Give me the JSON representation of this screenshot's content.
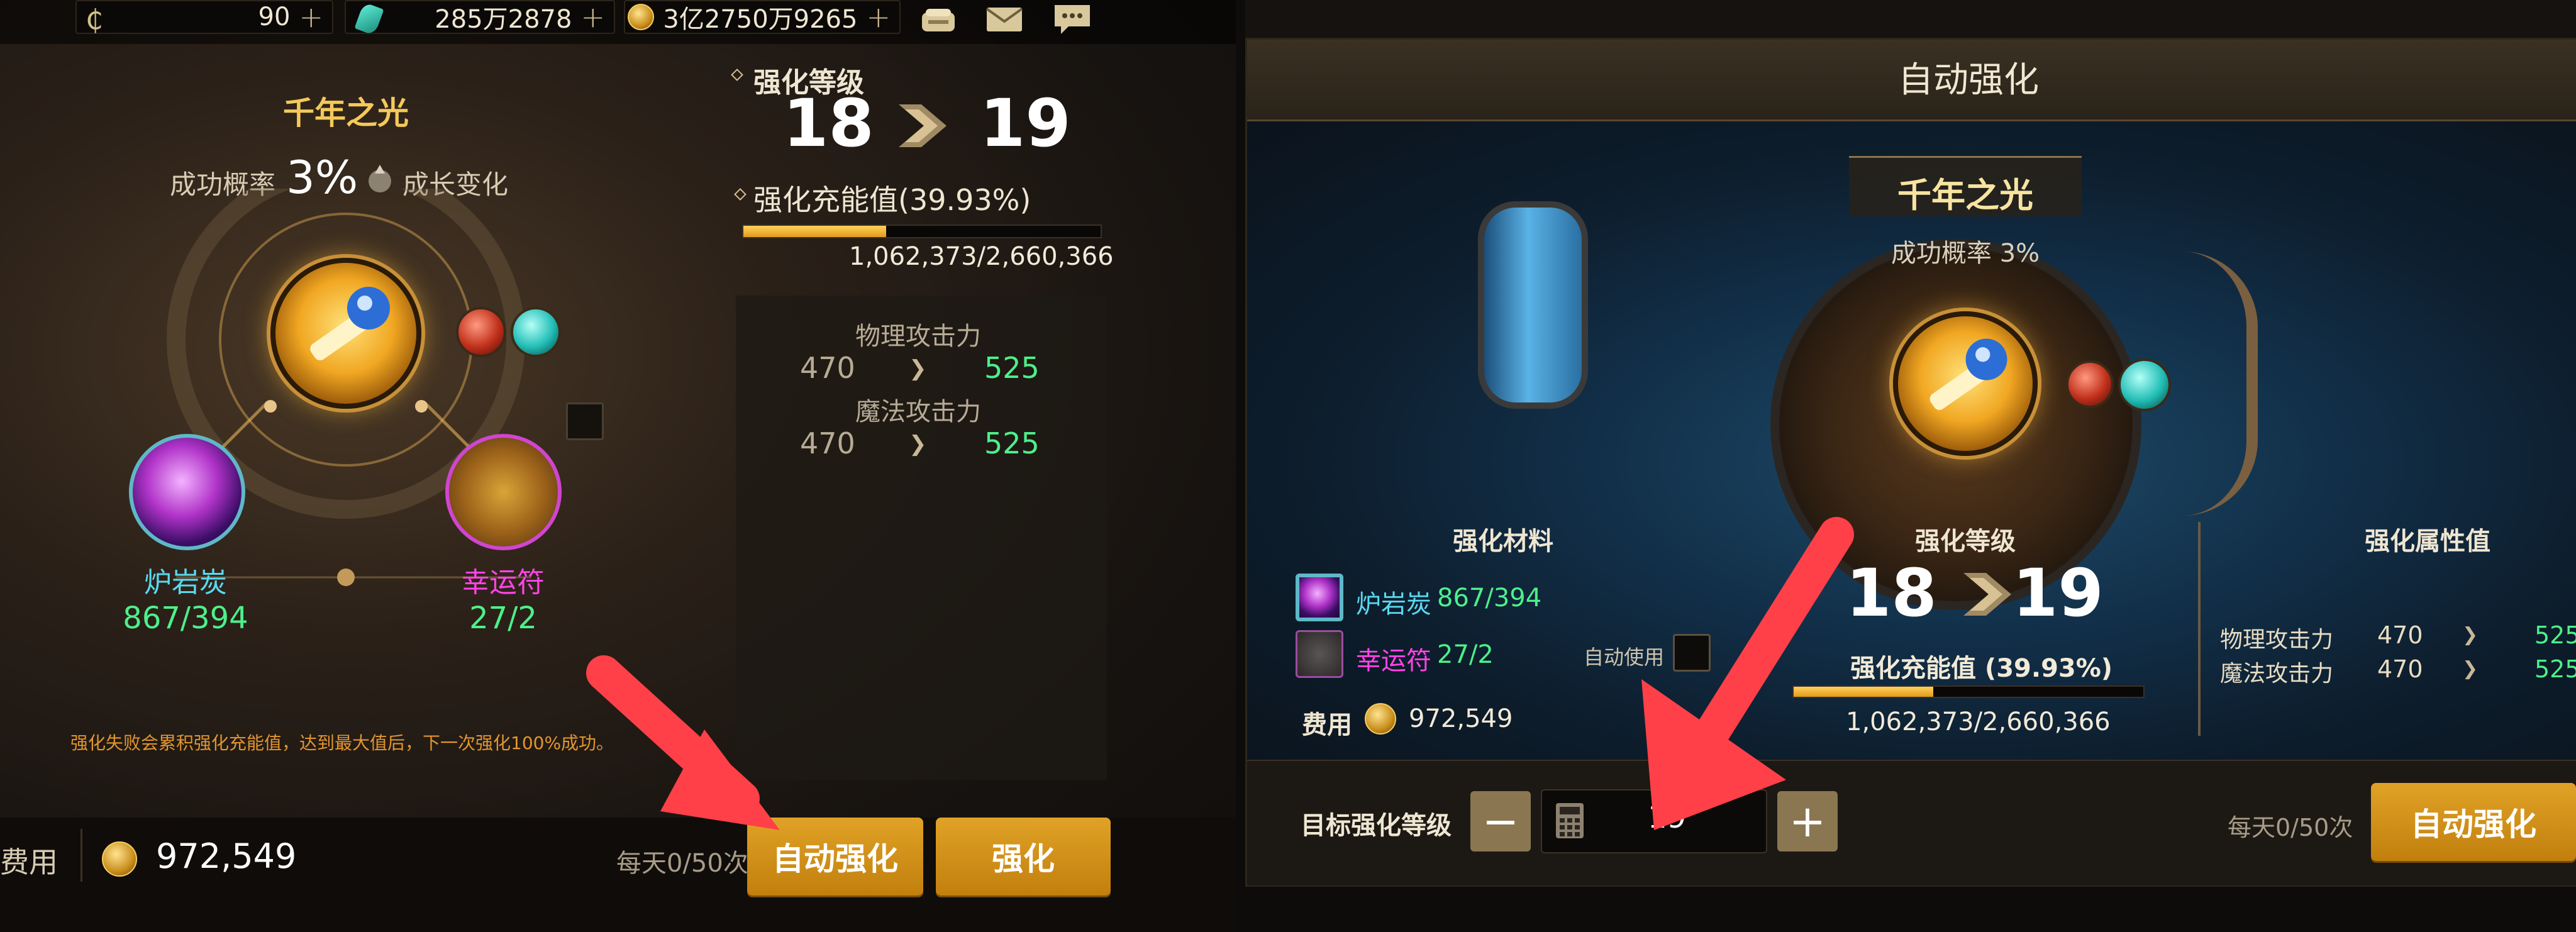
{
  "left": {
    "topbar": {
      "currency1": "90",
      "currency2": "285万2878",
      "currency3": "3亿2750万9265",
      "plus": "+"
    },
    "item_name": "千年之光",
    "success_rate_label": "成功概率",
    "success_rate_value": "3%",
    "growth_label": "成长变化",
    "materials": [
      {
        "name": "炉岩炭",
        "count": "867/394",
        "name_color": "#5ad8ef"
      },
      {
        "name": "幸运符",
        "count": "27/2",
        "name_color": "#ff44e6"
      }
    ],
    "enhance_level_label": "强化等级",
    "level_from": "18",
    "level_to": "19",
    "charge_label": "强化充能值(39.93%)",
    "charge_progress": 0.3993,
    "charge_value": "1,062,373/2,660,366",
    "stats": [
      {
        "name": "物理攻击力",
        "from": "470",
        "to": "525"
      },
      {
        "name": "魔法攻击力",
        "from": "470",
        "to": "525"
      }
    ],
    "notice": "强化失败会累积强化充能值，达到最大值后，下一次强化100%成功。",
    "cost_label": "费用",
    "cost_value": "972,549",
    "daily_limit": "每天0/50次",
    "auto_enhance_button": "自动强化",
    "enhance_button": "强化"
  },
  "right": {
    "title": "自动强化",
    "item_name": "千年之光",
    "success_rate": "成功概率 3%",
    "materials_header": "强化材料",
    "materials": [
      {
        "name": "炉岩炭",
        "count": "867/394"
      },
      {
        "name": "幸运符",
        "count": "27/2"
      }
    ],
    "auto_use_label": "自动使用",
    "cost_label": "费用",
    "cost_value": "972,549",
    "level_header": "强化等级",
    "level_from": "18",
    "level_to": "19",
    "charge_label": "强化充能值 (39.93%)",
    "charge_progress": 0.3993,
    "charge_value": "1,062,373/2,660,366",
    "attr_header": "强化属性值",
    "stats": [
      {
        "name": "物理攻击力",
        "from": "470",
        "to": "525"
      },
      {
        "name": "魔法攻击力",
        "from": "470",
        "to": "525"
      }
    ],
    "target_level_label": "目标强化等级",
    "target_level_value": "19",
    "minus": "−",
    "plus": "+",
    "daily_limit": "每天0/50次",
    "auto_enhance_button": "自动强化"
  },
  "colors": {
    "gold_button": "#d6951a",
    "arrow_red": "#ff4048",
    "stat_green": "#4df08a",
    "title_gold": "#f4c95a"
  },
  "icons": [
    "coin-icon",
    "gem-icon",
    "mailbox-icon",
    "mail-icon",
    "chat-icon",
    "calculator-icon",
    "chevron-right-icon"
  ]
}
